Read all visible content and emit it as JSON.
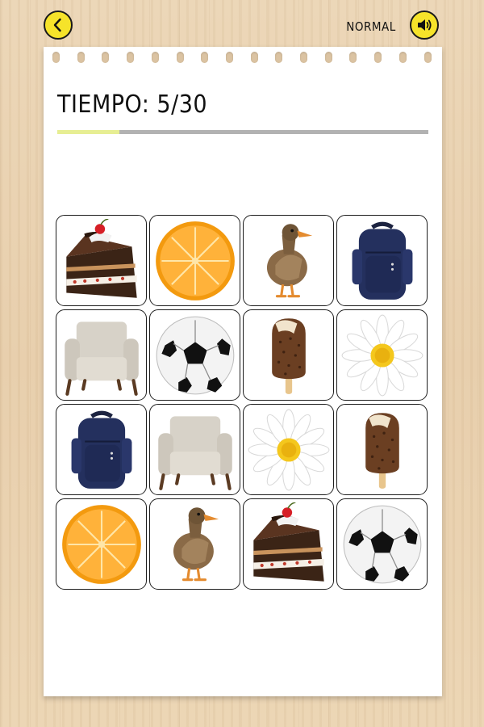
{
  "header": {
    "back_icon": "chevron-left-icon",
    "difficulty": "NORMAL",
    "sound_icon": "speaker-volume-icon",
    "accent_color": "#f6e32a"
  },
  "timer": {
    "label": "TIEMPO: 5/30",
    "elapsed": 5,
    "total": 30,
    "progress_fill_color": "#e7ee93"
  },
  "board": {
    "rows": 4,
    "columns": 4,
    "cards": [
      {
        "item": "cake",
        "face_up": true
      },
      {
        "item": "orange",
        "face_up": true
      },
      {
        "item": "duck",
        "face_up": true
      },
      {
        "item": "backpack",
        "face_up": true
      },
      {
        "item": "armchair",
        "face_up": true
      },
      {
        "item": "soccer-ball",
        "face_up": true
      },
      {
        "item": "ice-cream",
        "face_up": true
      },
      {
        "item": "daisy",
        "face_up": true
      },
      {
        "item": "backpack",
        "face_up": true
      },
      {
        "item": "armchair",
        "face_up": true
      },
      {
        "item": "daisy",
        "face_up": true
      },
      {
        "item": "ice-cream",
        "face_up": true
      },
      {
        "item": "orange",
        "face_up": true
      },
      {
        "item": "duck",
        "face_up": true
      },
      {
        "item": "cake",
        "face_up": true
      },
      {
        "item": "soccer-ball",
        "face_up": true
      }
    ]
  }
}
